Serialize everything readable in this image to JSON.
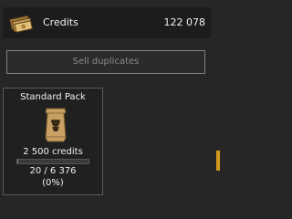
{
  "credits": {
    "label": "Credits",
    "value": "122 078",
    "icon": "credits-bundle-icon"
  },
  "sell_duplicates": {
    "label": "Sell duplicates"
  },
  "packs": [
    {
      "title": "Standard Pack",
      "icon": "card-pack-icon",
      "price": "2 500 credits",
      "progress_text": "20 / 6 376",
      "progress_percent_text": "(0%)",
      "progress_fraction": 0.003
    }
  ],
  "colors": {
    "background": "#262626",
    "accent": "#d49a1e",
    "pack_gold": "#c8a064"
  }
}
